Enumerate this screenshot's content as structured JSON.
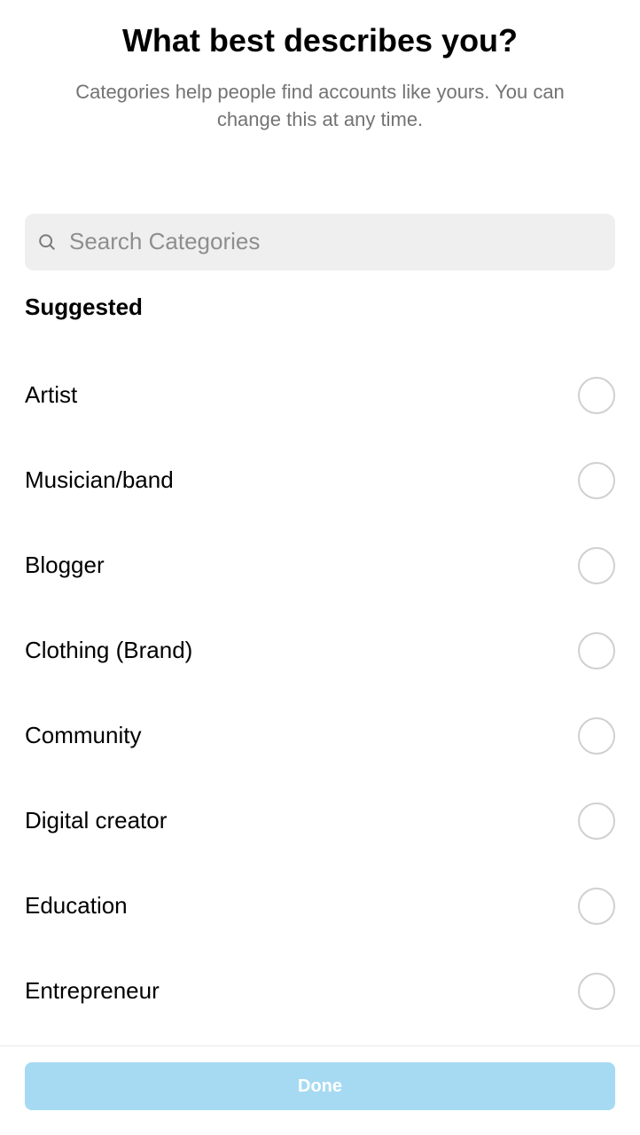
{
  "header": {
    "title": "What best describes you?",
    "subtitle": "Categories help people find accounts like yours. You can change this at any time."
  },
  "search": {
    "placeholder": "Search Categories",
    "value": ""
  },
  "section": {
    "title": "Suggested"
  },
  "categories": [
    {
      "label": "Artist"
    },
    {
      "label": "Musician/band"
    },
    {
      "label": "Blogger"
    },
    {
      "label": "Clothing (Brand)"
    },
    {
      "label": "Community"
    },
    {
      "label": "Digital creator"
    },
    {
      "label": "Education"
    },
    {
      "label": "Entrepreneur"
    }
  ],
  "footer": {
    "done_label": "Done"
  }
}
